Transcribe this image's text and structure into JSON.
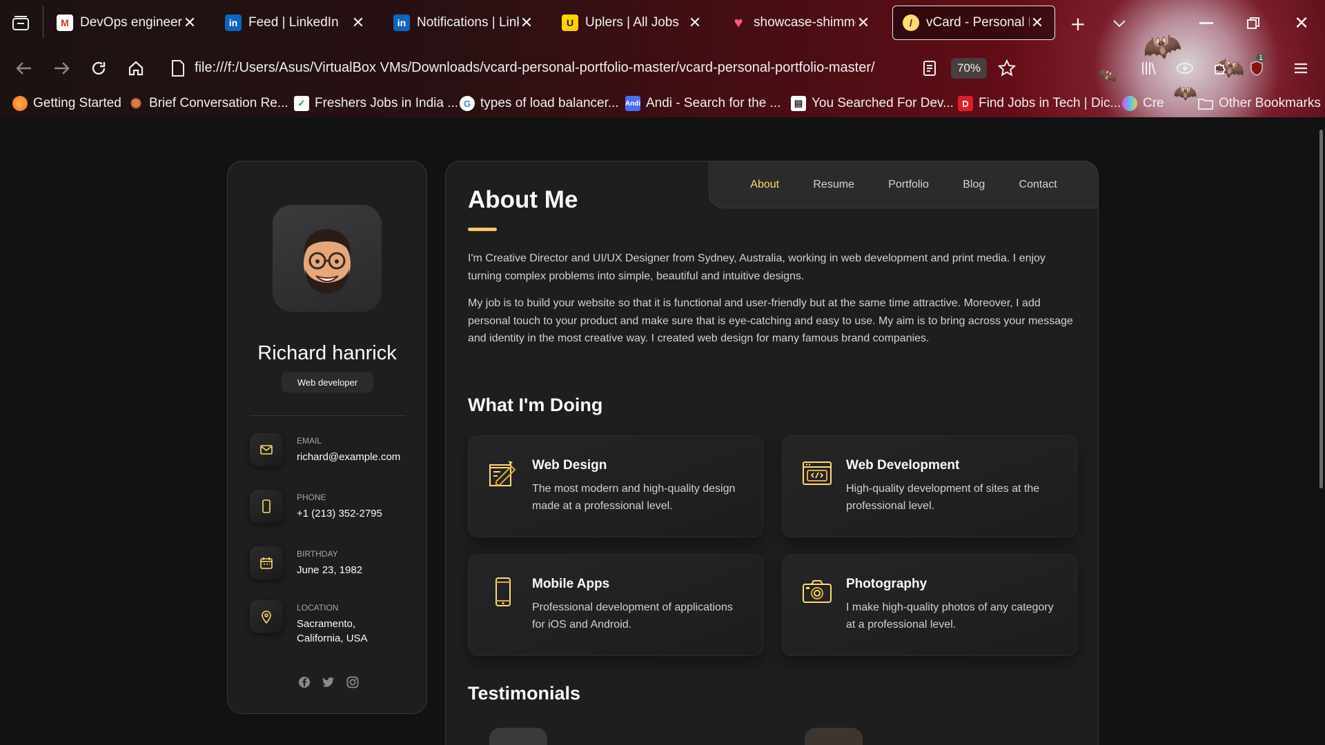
{
  "browser": {
    "tabs": [
      {
        "title": "DevOps engineer - a",
        "favicon": "gmail-icon",
        "active": false
      },
      {
        "title": "Feed | LinkedIn",
        "favicon": "linkedin-icon",
        "active": false
      },
      {
        "title": "Notifications | Linke",
        "favicon": "linkedin-icon",
        "active": false
      },
      {
        "title": "Uplers | All Jobs",
        "favicon": "uplers-icon",
        "active": false
      },
      {
        "title": "showcase-shimmer-",
        "favicon": "heart-icon",
        "active": false
      },
      {
        "title": "vCard - Personal Por",
        "favicon": "vcard-icon",
        "active": true
      }
    ],
    "url": "file:///f:/Users/Asus/VirtualBox VMs/Downloads/vcard-personal-portfolio-master/vcard-personal-portfolio-master/",
    "zoom": "70%",
    "extension_badge": "1",
    "bookmarks": [
      {
        "label": "Getting Started",
        "icon": "firefox-icon"
      },
      {
        "label": "Brief Conversation Re...",
        "icon": "sparkle-icon"
      },
      {
        "label": "Freshers Jobs in India ...",
        "icon": "freshers-icon"
      },
      {
        "label": "types of load balancer...",
        "icon": "google-icon"
      },
      {
        "label": "Andi - Search for the ...",
        "icon": "andi-icon"
      },
      {
        "label": "You Searched For Dev...",
        "icon": "page-icon"
      },
      {
        "label": "Find Jobs in Tech | Dic...",
        "icon": "dice-icon"
      },
      {
        "label": "Cre",
        "icon": "colors-icon"
      },
      {
        "label": "Other Bookmarks",
        "icon": "folder-icon"
      }
    ]
  },
  "profile": {
    "name": "Richard hanrick",
    "role": "Web developer",
    "contacts": [
      {
        "label": "Email",
        "value": "richard@example.com",
        "icon": "mail-icon"
      },
      {
        "label": "Phone",
        "value": "+1 (213) 352-2795",
        "icon": "phone-icon"
      },
      {
        "label": "Birthday",
        "value": "June 23, 1982",
        "icon": "calendar-icon"
      },
      {
        "label": "Location",
        "value": "Sacramento, California, USA",
        "icon": "location-icon"
      }
    ],
    "socials": [
      "facebook-icon",
      "twitter-icon",
      "instagram-icon"
    ]
  },
  "nav": {
    "items": [
      "About",
      "Resume",
      "Portfolio",
      "Blog",
      "Contact"
    ],
    "active": "About"
  },
  "about": {
    "title": "About Me",
    "paragraphs": [
      "I'm Creative Director and UI/UX Designer from Sydney, Australia, working in web development and print media. I enjoy turning complex problems into simple, beautiful and intuitive designs.",
      "My job is to build your website so that it is functional and user-friendly but at the same time attractive. Moreover, I add personal touch to your product and make sure that is eye-catching and easy to use. My aim is to bring across your message and identity in the most creative way. I created web design for many famous brand companies."
    ],
    "services_title": "What I'm Doing",
    "services": [
      {
        "title": "Web Design",
        "text": "The most modern and high-quality design made at a professional level.",
        "icon": "design-icon"
      },
      {
        "title": "Web Development",
        "text": "High-quality development of sites at the professional level.",
        "icon": "dev-icon"
      },
      {
        "title": "Mobile Apps",
        "text": "Professional development of applications for iOS and Android.",
        "icon": "mobile-icon"
      },
      {
        "title": "Photography",
        "text": "I make high-quality photos of any category at a professional level.",
        "icon": "camera-icon"
      }
    ],
    "testimonials_title": "Testimonials"
  },
  "colors": {
    "accent": "#ffdb70",
    "background": "#121212",
    "card": "#1e1e1f"
  }
}
